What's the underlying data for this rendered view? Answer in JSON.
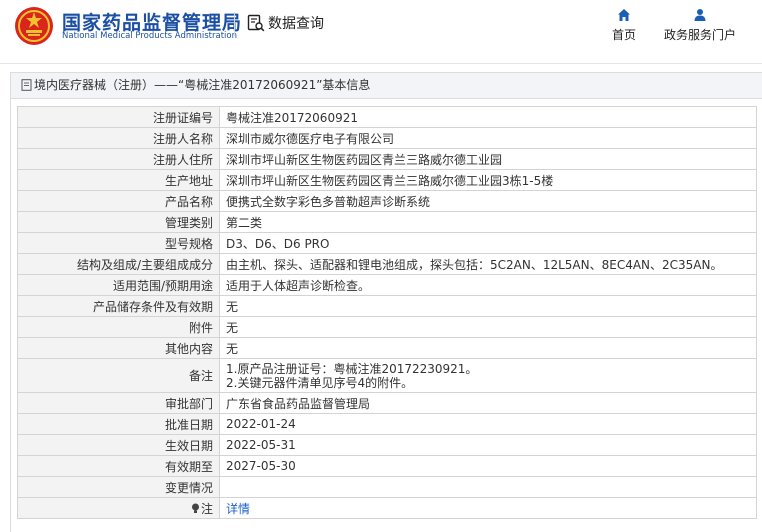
{
  "header": {
    "brand_cn": "国家药品监督管理局",
    "brand_en": "National Medical Products Administration",
    "query_label": "数据查询",
    "nav": [
      {
        "label": "首页",
        "icon": "home-icon"
      },
      {
        "label": "政务服务门户",
        "icon": "user-icon"
      }
    ],
    "colors": {
      "brand": "#1b4fa3",
      "nav_icon": "#1a5fb4",
      "logo_red": "#d9251c",
      "logo_gold": "#f2c12e"
    }
  },
  "panel": {
    "title": "境内医疗器械（注册）——“粤械注准20172060921”基本信息"
  },
  "rows": [
    {
      "label": "注册证编号",
      "value": "粤械注准20172060921"
    },
    {
      "label": "注册人名称",
      "value": "深圳市威尔德医疗电子有限公司"
    },
    {
      "label": "注册人住所",
      "value": "深圳市坪山新区生物医药园区青兰三路威尔德工业园"
    },
    {
      "label": "生产地址",
      "value": "深圳市坪山新区生物医药园区青兰三路威尔德工业园3栋1-5楼"
    },
    {
      "label": "产品名称",
      "value": "便携式全数字彩色多普勒超声诊断系统"
    },
    {
      "label": "管理类别",
      "value": "第二类"
    },
    {
      "label": "型号规格",
      "value": "D3、D6、D6 PRO"
    },
    {
      "label": "结构及组成/主要组成成分",
      "value": "由主机、探头、适配器和锂电池组成，探头包括：5C2AN、12L5AN、8EC4AN、2C35AN。"
    },
    {
      "label": "适用范围/预期用途",
      "value": "适用于人体超声诊断检查。"
    },
    {
      "label": "产品储存条件及有效期",
      "value": "无"
    },
    {
      "label": "附件",
      "value": "无"
    },
    {
      "label": "其他内容",
      "value": "无"
    },
    {
      "label": "备注",
      "lines": [
        "1.原产品注册证号：粤械注准20172230921。",
        "2.关键元器件清单见序号4的附件。"
      ]
    },
    {
      "label": "审批部门",
      "value": "广东省食品药品监督管理局"
    },
    {
      "label": "批准日期",
      "value": "2022-01-24"
    },
    {
      "label": "生效日期",
      "value": "2022-05-31"
    },
    {
      "label": "有效期至",
      "value": "2027-05-30"
    },
    {
      "label": "变更情况",
      "value": ""
    },
    {
      "label": "注",
      "value": "详情",
      "icon": "lightbulb-icon"
    }
  ]
}
